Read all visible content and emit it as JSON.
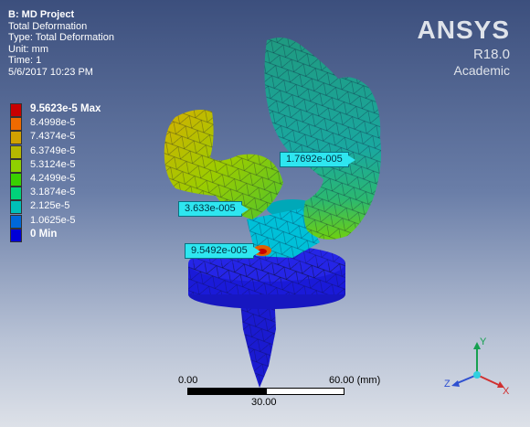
{
  "header": {
    "title": "B: MD Project",
    "lines": [
      "Total Deformation",
      "Type: Total Deformation",
      "Unit: mm",
      "Time: 1",
      "5/6/2017 10:23 PM"
    ]
  },
  "brand": {
    "name": "ANSYS",
    "version": "R18.0",
    "edition": "Academic"
  },
  "legend": [
    {
      "label": "9.5623e-5 Max",
      "color": "#c80000"
    },
    {
      "label": "8.4998e-5",
      "color": "#ee6a00"
    },
    {
      "label": "7.4374e-5",
      "color": "#d0a100"
    },
    {
      "label": "6.3749e-5",
      "color": "#b5b800"
    },
    {
      "label": "5.3124e-5",
      "color": "#8fd000"
    },
    {
      "label": "4.2499e-5",
      "color": "#39d000"
    },
    {
      "label": "3.1874e-5",
      "color": "#00d27a"
    },
    {
      "label": "2.125e-5",
      "color": "#00c0b8"
    },
    {
      "label": "1.0625e-5",
      "color": "#0068d8"
    },
    {
      "label": "0 Min",
      "color": "#0000d8"
    }
  ],
  "probes": [
    "1.7692e-005",
    "3.633e-005",
    "9.5492e-005"
  ],
  "scale": {
    "left": "0.00",
    "right": "60.00 (mm)",
    "mid": "30.00"
  },
  "triad": {
    "x": "X",
    "y": "Y",
    "z": "Z"
  }
}
